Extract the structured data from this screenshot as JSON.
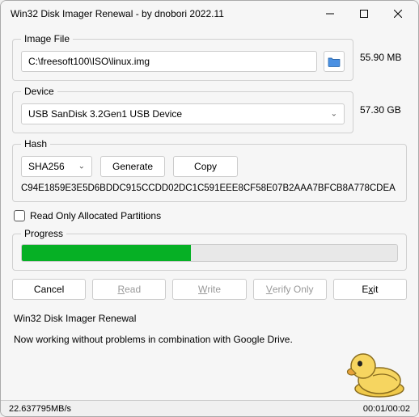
{
  "titlebar": {
    "title": "Win32 Disk Imager Renewal - by dnobori 2022.11"
  },
  "image_file": {
    "legend": "Image File",
    "path": "C:\\freesoft100\\ISO\\linux.img",
    "folder_icon": "folder-icon",
    "size": "55.90 MB"
  },
  "device": {
    "legend": "Device",
    "selected": "USB  SanDisk 3.2Gen1 USB Device",
    "size": "57.30 GB"
  },
  "hash": {
    "legend": "Hash",
    "algo": "SHA256",
    "generate_label": "Generate",
    "copy_label": "Copy",
    "value": "C94E1859E3E5D6BDDC915CCDD02DC1C591EEE8CF58E07B2AAA7BFCB8A778CDEA"
  },
  "read_only_label": "Read Only Allocated Partitions",
  "progress": {
    "legend": "Progress",
    "percent": 45
  },
  "actions": {
    "cancel": "Cancel",
    "read": "Read",
    "write": "Write",
    "verify": "Verify Only",
    "exit": "Exit"
  },
  "footer": {
    "line1": "Win32 Disk Imager Renewal",
    "line2": "Now working without problems in combination with Google Drive."
  },
  "status": {
    "speed": "22.637795MB/s",
    "time": "00:01/00:02"
  }
}
